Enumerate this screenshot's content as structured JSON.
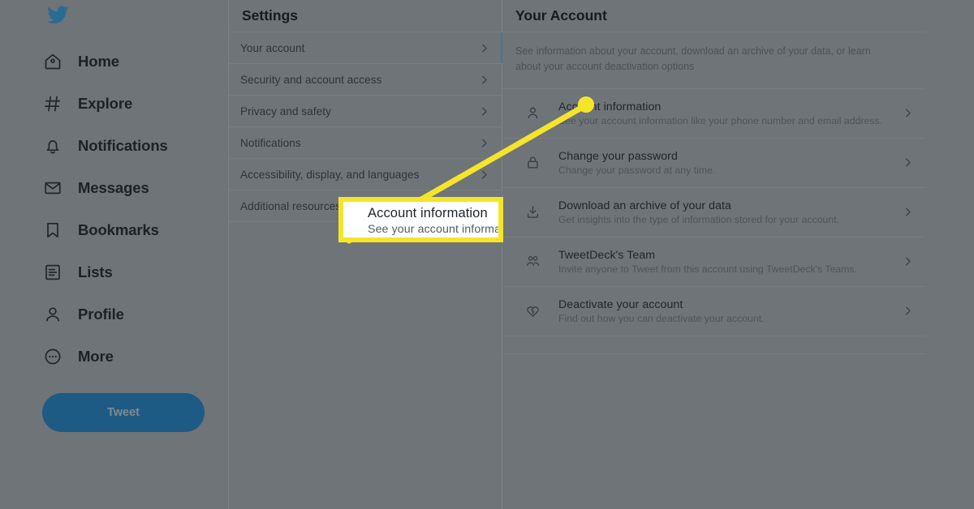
{
  "colors": {
    "page_background": "#6e7478",
    "brand_blue": "#1d5b84",
    "accent_bar": "#3f7a96",
    "annotation_yellow": "#f5e52a",
    "callout_background": "#ffffff"
  },
  "nav": {
    "logo_icon": "twitter-bird-icon",
    "items": [
      {
        "label": "Home",
        "icon": "home-icon"
      },
      {
        "label": "Explore",
        "icon": "hashtag-icon"
      },
      {
        "label": "Notifications",
        "icon": "bell-icon"
      },
      {
        "label": "Messages",
        "icon": "envelope-icon"
      },
      {
        "label": "Bookmarks",
        "icon": "bookmark-icon"
      },
      {
        "label": "Lists",
        "icon": "list-icon"
      },
      {
        "label": "Profile",
        "icon": "person-icon"
      },
      {
        "label": "More",
        "icon": "more-circle-icon"
      }
    ],
    "tweet_button_label": "Tweet"
  },
  "settings": {
    "header": "Settings",
    "items": [
      {
        "label": "Your account",
        "active": true
      },
      {
        "label": "Security and account access",
        "active": false
      },
      {
        "label": "Privacy and safety",
        "active": false
      },
      {
        "label": "Notifications",
        "active": false
      },
      {
        "label": "Accessibility, display, and languages",
        "active": false
      },
      {
        "label": "Additional resources",
        "active": false
      }
    ]
  },
  "detail": {
    "header": "Your Account",
    "description": "See information about your account, download an archive of your data, or learn about your account deactivation options",
    "rows": [
      {
        "icon": "person-icon",
        "title": "Account information",
        "subtitle": "See your account information like your phone number and email address."
      },
      {
        "icon": "lock-icon",
        "title": "Change your password",
        "subtitle": "Change your password at any time."
      },
      {
        "icon": "download-icon",
        "title": "Download an archive of your data",
        "subtitle": "Get insights into the type of information stored for your account."
      },
      {
        "icon": "people-group-icon",
        "title": "TweetDeck's Team",
        "subtitle": "Invite anyone to Tweet from this account using TweetDeck's Teams."
      },
      {
        "icon": "broken-heart-icon",
        "title": "Deactivate your account",
        "subtitle": "Find out how you can deactivate your account."
      }
    ]
  },
  "annotation": {
    "callout_title": "Account information",
    "callout_subtitle": "See your account informatio"
  }
}
